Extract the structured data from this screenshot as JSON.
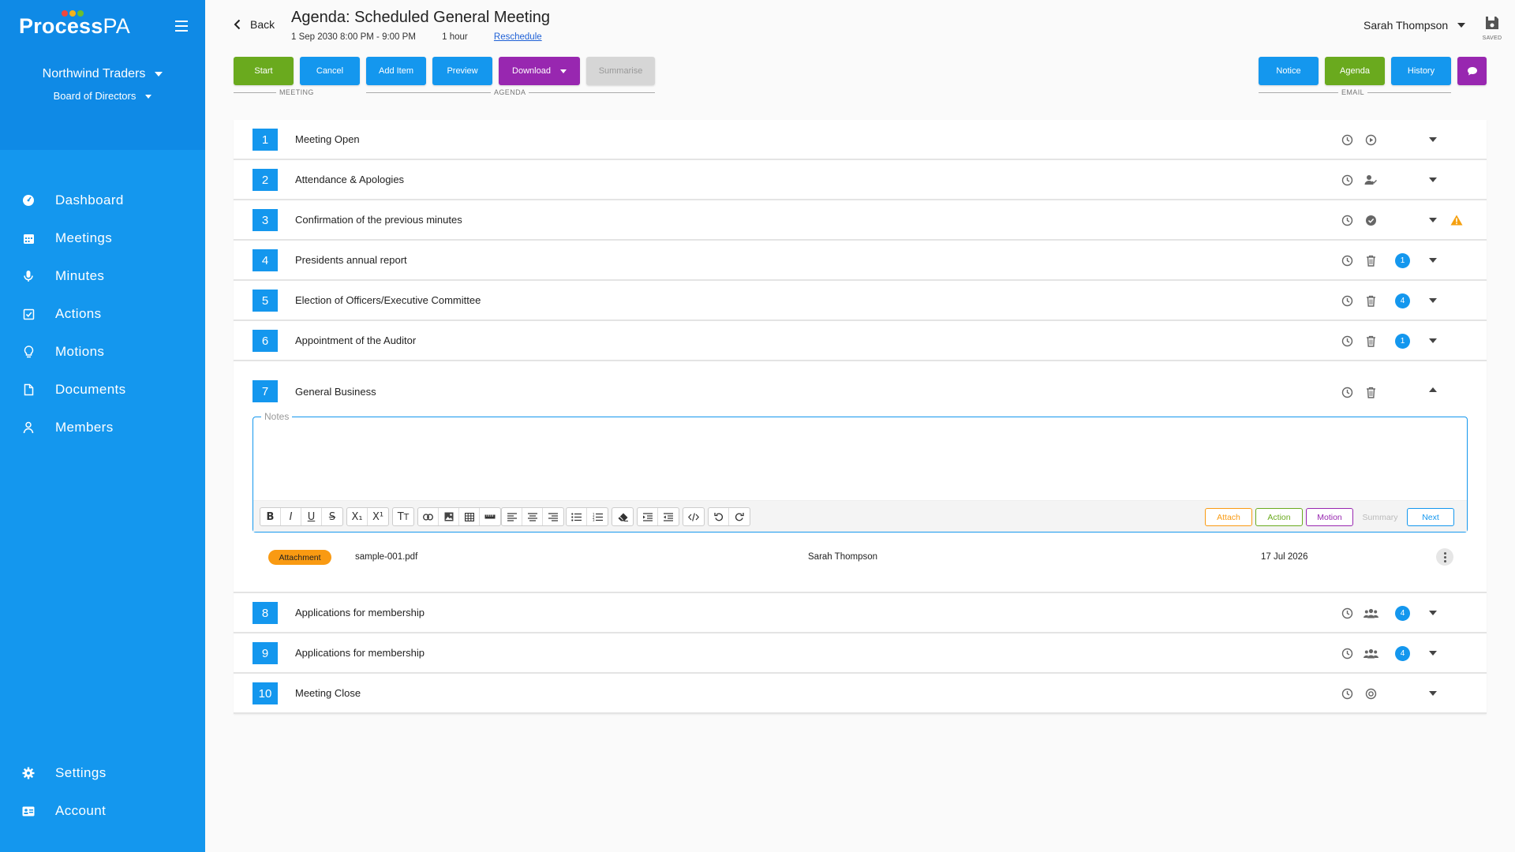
{
  "brand": {
    "name_a": "Process",
    "name_b": "PA",
    "dots": [
      "#f0473d",
      "#f7b21b",
      "#6bbf2e"
    ]
  },
  "sidebar": {
    "org": "Northwind Traders",
    "board": "Board of Directors",
    "items": [
      {
        "label": "Dashboard",
        "icon": "dashboard-icon"
      },
      {
        "label": "Meetings",
        "icon": "calendar-icon"
      },
      {
        "label": "Minutes",
        "icon": "microphone-icon"
      },
      {
        "label": "Actions",
        "icon": "checkbox-icon"
      },
      {
        "label": "Motions",
        "icon": "lightbulb-icon"
      },
      {
        "label": "Documents",
        "icon": "document-icon"
      },
      {
        "label": "Members",
        "icon": "person-icon"
      }
    ],
    "bottom": [
      {
        "label": "Settings",
        "icon": "gear-icon"
      },
      {
        "label": "Account",
        "icon": "id-card-icon"
      }
    ]
  },
  "header": {
    "back": "Back",
    "title": "Agenda: Scheduled General Meeting",
    "datetime": "1 Sep 2030 8:00 PM - 9:00 PM",
    "duration": "1 hour",
    "reschedule": "Reschedule",
    "user": "Sarah Thompson",
    "saved": "SAVED"
  },
  "toolbar": {
    "start": "Start",
    "cancel": "Cancel",
    "add_item": "Add Item",
    "preview": "Preview",
    "download": "Download",
    "summarise": "Summarise",
    "notice": "Notice",
    "agenda": "Agenda",
    "history": "History",
    "group_meeting": "MEETING",
    "group_agenda": "AGENDA",
    "group_email": "EMAIL"
  },
  "agenda": {
    "items": [
      {
        "num": "1",
        "title": "Meeting Open"
      },
      {
        "num": "2",
        "title": "Attendance & Apologies"
      },
      {
        "num": "3",
        "title": "Confirmation of the previous minutes"
      },
      {
        "num": "4",
        "title": "Presidents annual report",
        "badge": "1"
      },
      {
        "num": "5",
        "title": "Election of Officers/Executive Committee",
        "badge": "4"
      },
      {
        "num": "6",
        "title": "Appointment of the Auditor",
        "badge": "1"
      },
      {
        "num": "7",
        "title": "General Business"
      },
      {
        "num": "8",
        "title": "Applications for membership",
        "badge": "4"
      },
      {
        "num": "9",
        "title": "Applications for membership",
        "badge": "4"
      },
      {
        "num": "10",
        "title": "Meeting Close"
      }
    ],
    "notes_label": "Notes",
    "editor_actions": {
      "attach": "Attach",
      "action": "Action",
      "motion": "Motion",
      "summary": "Summary",
      "next": "Next"
    },
    "attachment": {
      "badge": "Attachment",
      "file": "sample-001.pdf",
      "user": "Sarah Thompson",
      "date": "17 Jul 2026"
    }
  },
  "colors": {
    "primary": "#1497ee",
    "green": "#6aaa1e",
    "purple": "#9827b0",
    "orange": "#f99a12",
    "warning": "#f5a00f"
  }
}
